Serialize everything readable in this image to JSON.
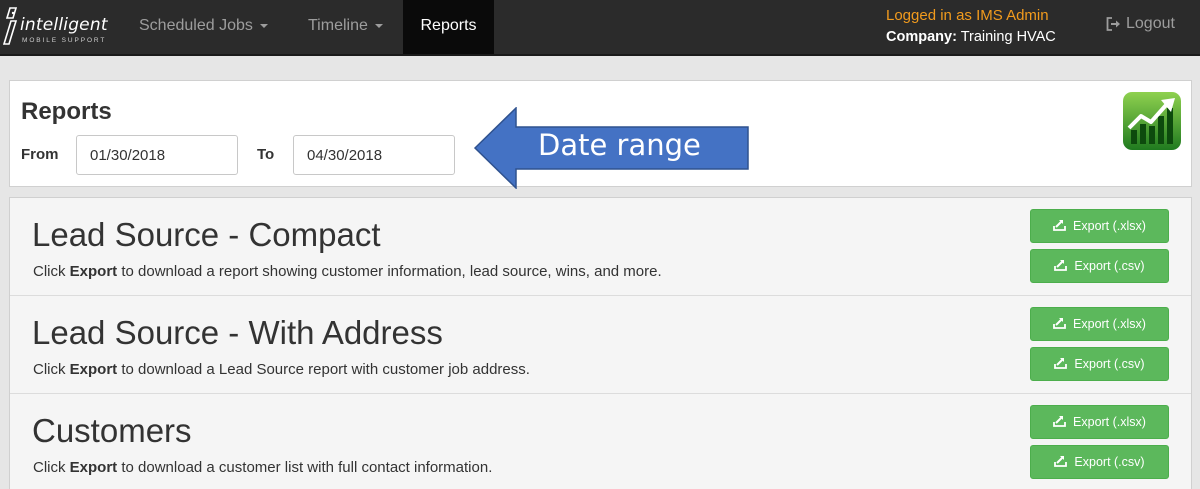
{
  "brand": {
    "name": "intelligent",
    "tagline": "MOBILE SUPPORT",
    "logo_icon": "intelligent-i-logo"
  },
  "nav": {
    "items": [
      {
        "label": "Scheduled Jobs",
        "dropdown": true
      },
      {
        "label": "Timeline",
        "dropdown": true
      },
      {
        "label": "Reports",
        "active": true
      }
    ]
  },
  "user": {
    "logged_in_text": "Logged in as IMS Admin",
    "company_label": "Company:",
    "company_name": "Training HVAC",
    "logout_label": "Logout",
    "logout_icon": "logout-icon"
  },
  "reports_header": {
    "title": "Reports",
    "from_label": "From",
    "from_value": "01/30/2018",
    "to_label": "To",
    "to_value": "04/30/2018",
    "annotation": "Date range",
    "report_icon": "chart-trend-icon"
  },
  "reports": [
    {
      "title": "Lead Source - Compact",
      "desc_prefix": "Click ",
      "desc_bold": "Export",
      "desc_suffix": " to download a report showing customer information, lead source, wins, and more.",
      "btn_xlsx": "Export (.xlsx)",
      "btn_csv": "Export (.csv)"
    },
    {
      "title": "Lead Source - With Address",
      "desc_prefix": "Click ",
      "desc_bold": "Export",
      "desc_suffix": " to download a Lead Source report with customer job address.",
      "btn_xlsx": "Export (.xlsx)",
      "btn_csv": "Export (.csv)"
    },
    {
      "title": "Customers",
      "desc_prefix": "Click ",
      "desc_bold": "Export",
      "desc_suffix": " to download a customer list with full contact information.",
      "btn_xlsx": "Export (.xlsx)",
      "btn_csv": "Export (.csv)"
    }
  ],
  "colors": {
    "navbar_bg": "#2b2b2b",
    "nav_active_bg": "#0a0a0a",
    "user_highlight": "#f29b1d",
    "button_green": "#5cb85c",
    "annotation_arrow": "#4472c4"
  }
}
